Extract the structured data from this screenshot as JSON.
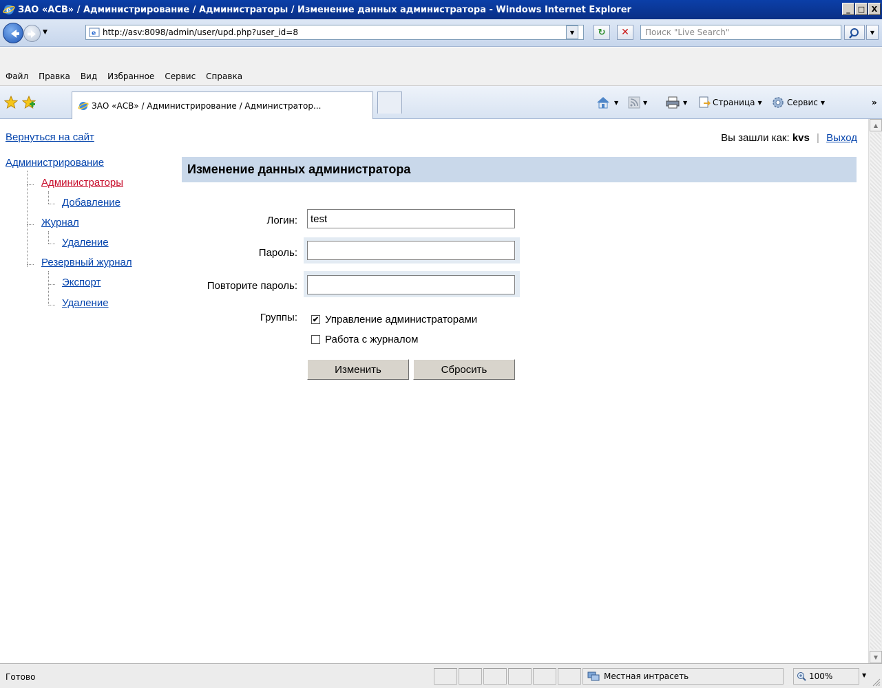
{
  "window": {
    "title": "ЗАО «АСВ» / Администрирование / Администраторы / Изменение данных администратора - Windows Internet Explorer",
    "minimize": "_",
    "maximize": "□",
    "close": "X"
  },
  "address_bar": {
    "url": "http://asv:8098/admin/user/upd.php?user_id=8",
    "search_placeholder": "Поиск \"Live Search\""
  },
  "menu": {
    "items": [
      "Файл",
      "Правка",
      "Вид",
      "Избранное",
      "Сервис",
      "Справка"
    ]
  },
  "tabs": {
    "active_title": "ЗАО «АСВ» / Администрирование / Администратор...",
    "more": "»"
  },
  "command_bar": {
    "page_label": "Страница",
    "tools_label": "Сервис"
  },
  "page": {
    "back_link": "Вернуться на сайт",
    "user_prefix": "Вы зашли как:",
    "user_name": "kvs",
    "user_separator": "|",
    "logout": "Выход",
    "tree": {
      "root": "Администрирование",
      "administrators": "Администраторы",
      "add": "Добавление",
      "journal": "Журнал",
      "journal_delete": "Удаление",
      "backup_journal": "Резервный журнал",
      "export": "Экспорт",
      "backup_delete": "Удаление"
    },
    "header": "Изменение данных администратора",
    "form": {
      "login_label": "Логин:",
      "login_value": "test",
      "password_label": "Пароль:",
      "password_value": "",
      "repeat_label": "Повторите пароль:",
      "repeat_value": "",
      "groups_label": "Группы:",
      "groups": [
        {
          "label": "Управление администраторами",
          "checked": true
        },
        {
          "label": "Работа с журналом",
          "checked": false
        }
      ],
      "submit_label": "Изменить",
      "reset_label": "Сбросить"
    }
  },
  "status_bar": {
    "text": "Готово",
    "zone": "Местная интрасеть",
    "zoom": "100%"
  },
  "colors": {
    "title_bar": "#0a2f86",
    "header_bar": "#c9d8ea",
    "link": "#0645ad",
    "active_link": "#c8102e"
  }
}
